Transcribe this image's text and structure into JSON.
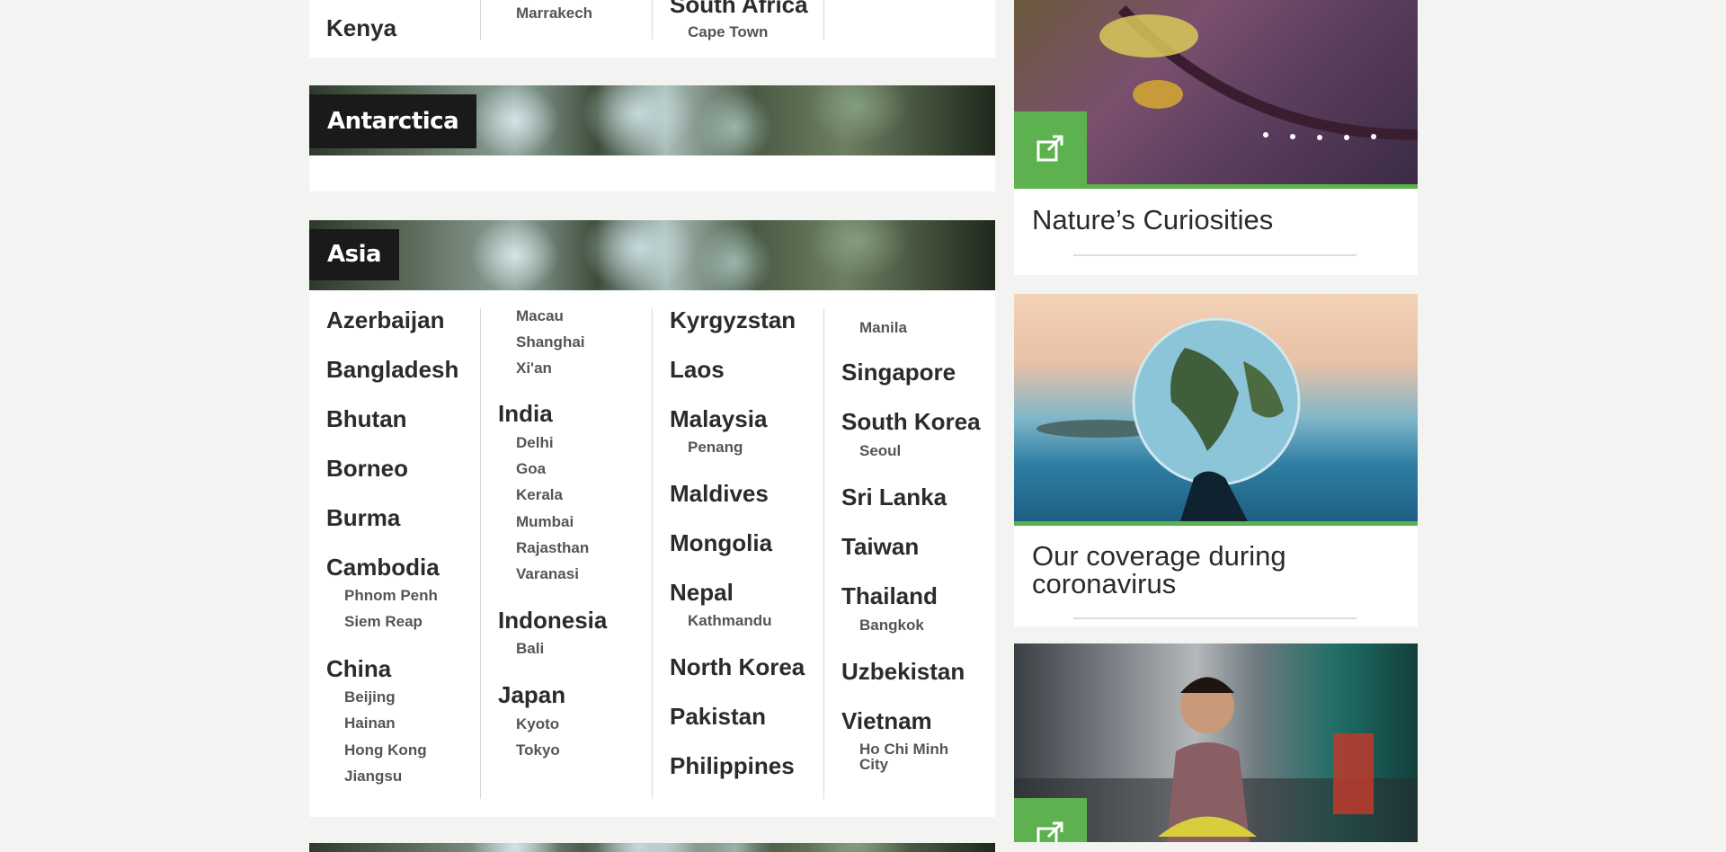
{
  "africa_tail": {
    "col1": {
      "country": "Kenya"
    },
    "col2": {
      "city": "Marrakech"
    },
    "col3": {
      "country": "South Africa",
      "city": "Cape Town"
    }
  },
  "antarctica": {
    "title": "Antarctica"
  },
  "asia": {
    "title": "Asia",
    "col1": {
      "azerbaijan": "Azerbaijan",
      "bangladesh": "Bangladesh",
      "bhutan": "Bhutan",
      "borneo": "Borneo",
      "burma": "Burma",
      "cambodia": "Cambodia",
      "phnom_penh": "Phnom Penh",
      "siem_reap": "Siem Reap",
      "china": "China",
      "beijing": "Beijing",
      "hainan": "Hainan",
      "hong_kong": "Hong Kong",
      "jiangsu": "Jiangsu"
    },
    "col2": {
      "macau": "Macau",
      "shanghai": "Shanghai",
      "xian": "Xi'an",
      "india": "India",
      "delhi": "Delhi",
      "goa": "Goa",
      "kerala": "Kerala",
      "mumbai": "Mumbai",
      "rajasthan": "Rajasthan",
      "varanasi": "Varanasi",
      "indonesia": "Indonesia",
      "bali": "Bali",
      "japan": "Japan",
      "kyoto": "Kyoto",
      "tokyo": "Tokyo"
    },
    "col3": {
      "kyrgyzstan": "Kyrgyzstan",
      "laos": "Laos",
      "malaysia": "Malaysia",
      "penang": "Penang",
      "maldives": "Maldives",
      "mongolia": "Mongolia",
      "nepal": "Nepal",
      "kathmandu": "Kathmandu",
      "north_korea": "North Korea",
      "pakistan": "Pakistan",
      "philippines": "Philippines"
    },
    "col4": {
      "manila": "Manila",
      "singapore": "Singapore",
      "south_korea": "South Korea",
      "seoul": "Seoul",
      "sri_lanka": "Sri Lanka",
      "taiwan": "Taiwan",
      "thailand": "Thailand",
      "bangkok": "Bangkok",
      "uzbekistan": "Uzbekistan",
      "vietnam": "Vietnam",
      "ho_chi_minh": "Ho Chi Minh",
      "city": "City"
    }
  },
  "sidebar": {
    "card1": {
      "title": "Nature’s Curiosities"
    },
    "card2": {
      "title_line1": "Our coverage during",
      "title_line2": "coronavirus"
    }
  },
  "colors": {
    "accent_green": "#5db14e",
    "banner_label_bg": "#1a1a1a"
  },
  "icons": {
    "external_link": "external-link-icon"
  }
}
